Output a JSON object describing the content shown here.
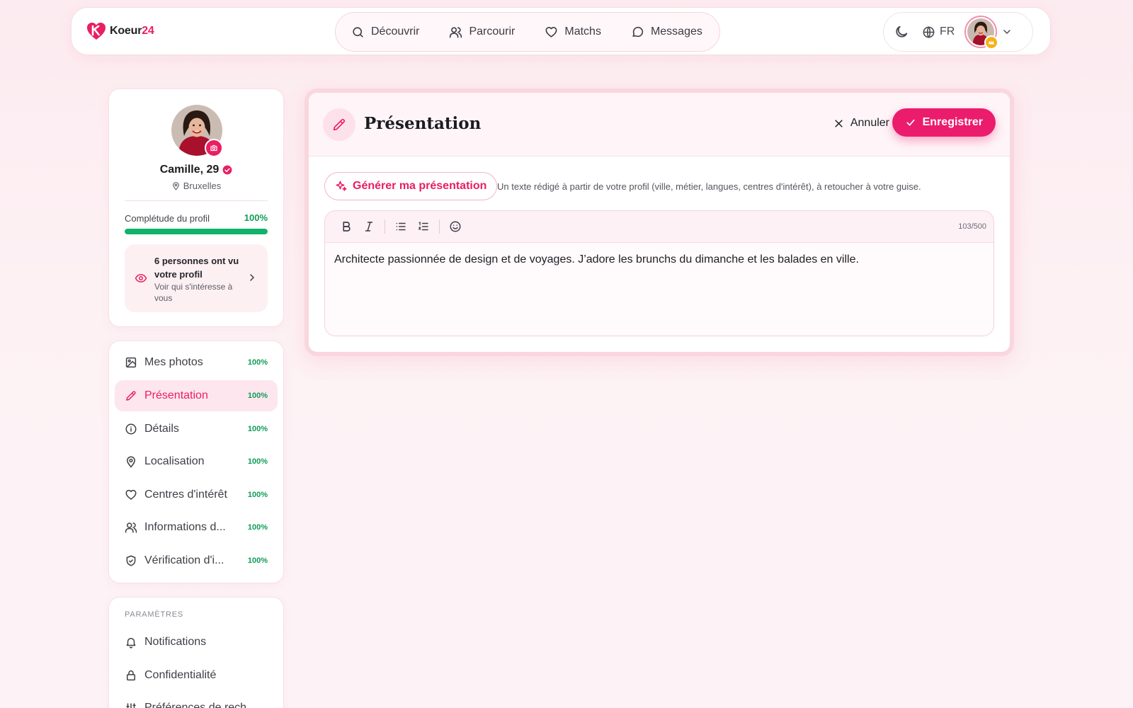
{
  "brand": {
    "name": "Koeur",
    "name_suffix": "24",
    "accent": "#e91e63"
  },
  "nav": {
    "items": [
      {
        "label": "Découvrir",
        "icon": "search-icon"
      },
      {
        "label": "Parcourir",
        "icon": "users-icon"
      },
      {
        "label": "Matchs",
        "icon": "heart-icon"
      },
      {
        "label": "Messages",
        "icon": "message-icon"
      }
    ],
    "language": "FR"
  },
  "profile": {
    "name": "Camille, 29",
    "city": "Bruxelles",
    "completion_label": "Complétude du profil",
    "completion_value": "100%",
    "completion_fraction": 1.0,
    "views_title": "6 personnes ont vu votre profil",
    "views_subtitle": "Voir qui s'intéresse à vous"
  },
  "sections": [
    {
      "label": "Mes photos",
      "percent": "100%",
      "icon": "image-icon"
    },
    {
      "label": "Présentation",
      "percent": "100%",
      "icon": "pencil-icon",
      "active": true
    },
    {
      "label": "Détails",
      "percent": "100%",
      "icon": "info-icon"
    },
    {
      "label": "Localisation",
      "percent": "100%",
      "icon": "map-pin-icon"
    },
    {
      "label": "Centres d'intérêt",
      "percent": "100%",
      "icon": "heart-icon"
    },
    {
      "label": "Informations d...",
      "percent": "100%",
      "icon": "users-icon"
    },
    {
      "label": "Vérification d'i...",
      "percent": "100%",
      "icon": "shield-check-icon"
    }
  ],
  "settings": {
    "heading": "PARAMÈTRES",
    "items": [
      {
        "label": "Notifications",
        "icon": "bell-icon"
      },
      {
        "label": "Confidentialité",
        "icon": "lock-icon"
      },
      {
        "label": "Préférences de rech",
        "icon": "sliders-icon"
      }
    ]
  },
  "editor": {
    "title": "Présentation",
    "cancel_label": "Annuler",
    "save_label": "Enregistrer",
    "generate_label": "Générer ma présentation",
    "generate_hint": "Un texte rédigé à partir de votre profil (ville, métier, langues, centres d'intérêt), à retoucher à votre guise.",
    "char_count": "103/500",
    "text": "Architecte passionnée de design et de voyages. J’adore les brunchs du dimanche et les balades en ville."
  },
  "colors": {
    "accent": "#e91e63",
    "success": "#0f9d58",
    "background": "#fcebf0"
  }
}
